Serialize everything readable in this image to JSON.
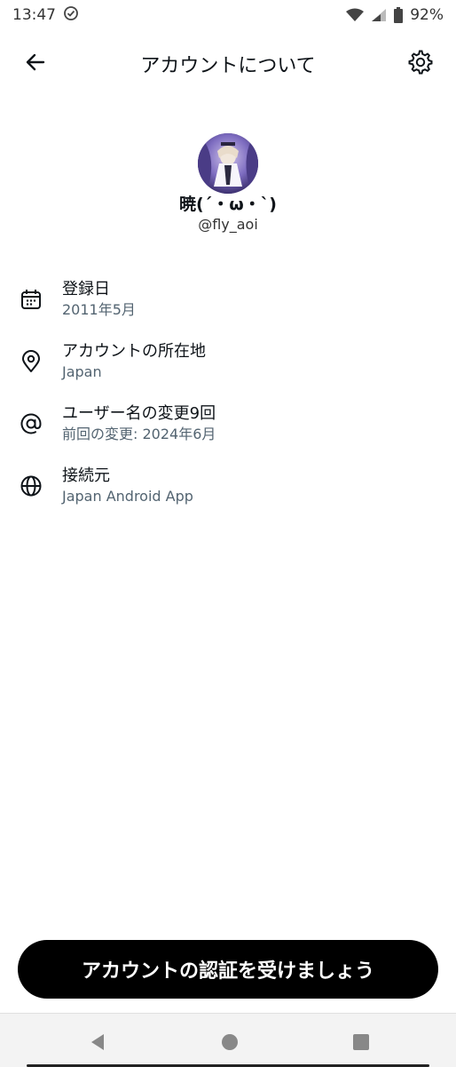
{
  "status_bar": {
    "time": "13:47",
    "battery": "92%",
    "icons": [
      "check-circle-icon",
      "wifi-icon",
      "signal-icon",
      "battery-icon"
    ]
  },
  "header": {
    "title": "アカウントについて",
    "back_icon": "arrow-left-icon",
    "settings_icon": "gear-icon"
  },
  "profile": {
    "display_name": "暁(´・ω・`)",
    "handle": "@fly_aoi"
  },
  "info": [
    {
      "icon": "calendar-icon",
      "label": "登録日",
      "value": "2011年5月"
    },
    {
      "icon": "location-pin-icon",
      "label": "アカウントの所在地",
      "value": "Japan"
    },
    {
      "icon": "at-sign-icon",
      "label": "ユーザー名の変更9回",
      "value": "前回の変更: 2024年6月"
    },
    {
      "icon": "globe-icon",
      "label": "接続元",
      "value": "Japan Android App"
    }
  ],
  "cta": {
    "label": "アカウントの認証を受けましょう"
  },
  "colors": {
    "text_primary": "#0f1419",
    "text_secondary": "#536471",
    "cta_background": "#000000",
    "cta_text": "#ffffff"
  }
}
